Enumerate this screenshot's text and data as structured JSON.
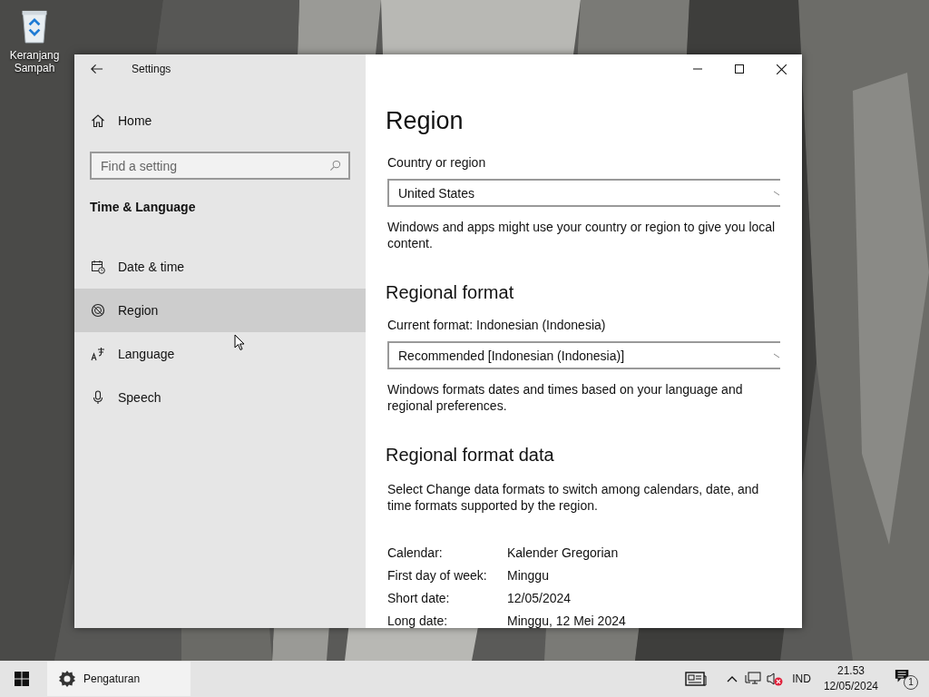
{
  "desktop": {
    "icons": [
      {
        "label": "Keranjang Sampah"
      }
    ]
  },
  "window": {
    "title": "Settings",
    "home": "Home",
    "search": {
      "placeholder": "Find a setting"
    },
    "section": "Time & Language",
    "nav": [
      {
        "label": "Date & time",
        "selected": false
      },
      {
        "label": "Region",
        "selected": true
      },
      {
        "label": "Language",
        "selected": false
      },
      {
        "label": "Speech",
        "selected": false
      }
    ]
  },
  "content": {
    "title": "Region",
    "country": {
      "label": "Country or region",
      "value": "United States",
      "note": "Windows and apps might use your country or region to give you local content."
    },
    "format": {
      "heading": "Regional format",
      "label": "Current format: Indonesian (Indonesia)",
      "value": "Recommended [Indonesian (Indonesia)]",
      "note": "Windows formats dates and times based on your language and regional preferences."
    },
    "format_data": {
      "heading": "Regional format data",
      "note": "Select Change data formats to switch among calendars, date, and time formats supported by the region.",
      "rows": [
        {
          "label": "Calendar:",
          "value": "Kalender Gregorian"
        },
        {
          "label": "First day of week:",
          "value": "Minggu"
        },
        {
          "label": "Short date:",
          "value": "12/05/2024"
        },
        {
          "label": "Long date:",
          "value": "Minggu, 12 Mei 2024"
        }
      ]
    }
  },
  "taskbar": {
    "app": "Pengaturan",
    "volume_muted": true,
    "language": "IND",
    "time": "21.53",
    "date": "12/05/2024",
    "notifications": "1"
  }
}
